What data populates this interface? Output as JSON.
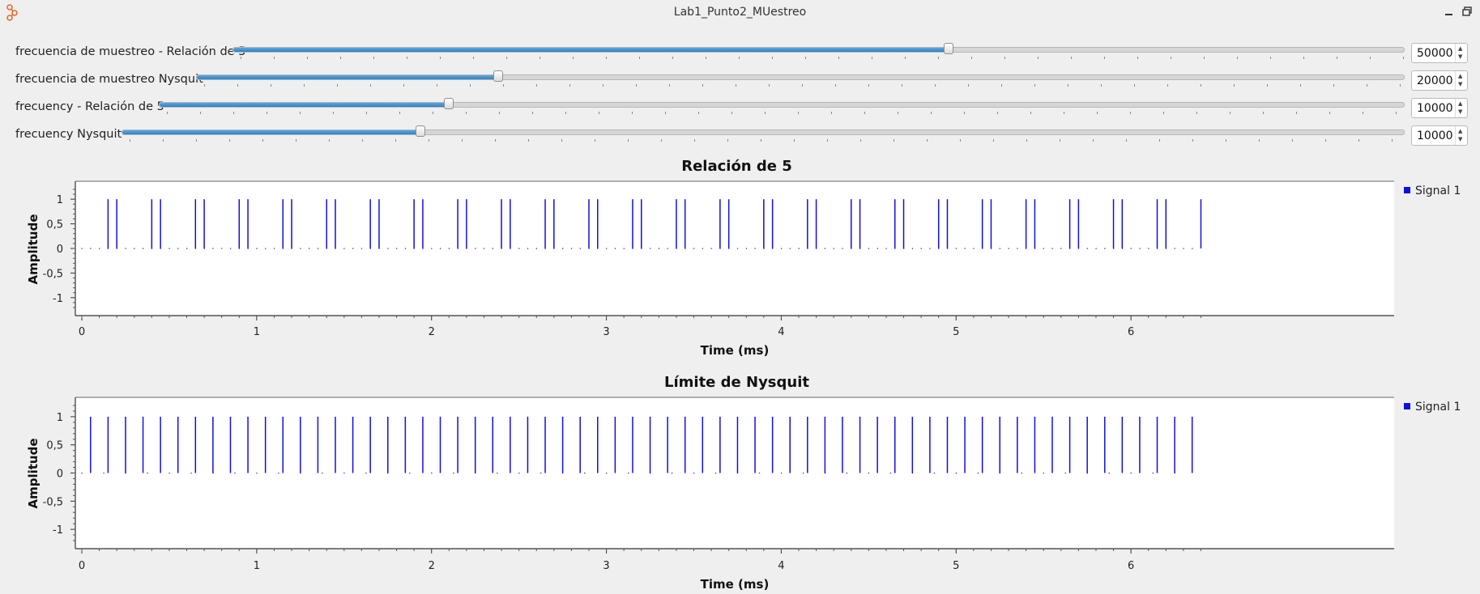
{
  "window": {
    "title": "Lab1_Punto2_MUestreo"
  },
  "controls": [
    {
      "label": "frecuencia de muestreo - Relación de 5",
      "value": "50000",
      "fraction": 0.612
    },
    {
      "label": "frecuencia de muestreo Nysquit",
      "value": "20000",
      "fraction": 0.25
    },
    {
      "label": "frecuency - Relación de 5",
      "value": "10000",
      "fraction": 0.233
    },
    {
      "label": "frecuency Nysquit",
      "value": "10000",
      "fraction": 0.233
    }
  ],
  "plots": [
    {
      "title": "Relación de 5",
      "xlabel": "Time (ms)",
      "ylabel": "Amplitude",
      "legend": "Signal 1",
      "x_ticks": [
        "0",
        "1",
        "2",
        "3",
        "4",
        "5",
        "6"
      ],
      "y_ticks": [
        "1",
        "0,5",
        "0",
        "-0,5",
        "-1"
      ],
      "chart_data": {
        "type": "stem",
        "xlim": [
          0,
          6.4
        ],
        "ylim": [
          -1.2,
          1.2
        ],
        "sample_interval_ms": 0.02,
        "pulse_period_ms": 0.25,
        "pulse_offsets_ms": [
          0.15,
          0.2
        ],
        "pulse_count": 26,
        "amplitude": 1,
        "color": "#1010e0"
      }
    },
    {
      "title": "Límite de Nysquit",
      "xlabel": "Time (ms)",
      "ylabel": "Amplitude",
      "legend": "Signal 1",
      "x_ticks": [
        "0",
        "1",
        "2",
        "3",
        "4",
        "5",
        "6"
      ],
      "y_ticks": [
        "1",
        "0,5",
        "0",
        "-0,5",
        "-1"
      ],
      "chart_data": {
        "type": "stem",
        "xlim": [
          0,
          6.4
        ],
        "ylim": [
          -1.2,
          1.2
        ],
        "sample_interval_ms": 0.05,
        "pulse_period_ms": 0.1,
        "pulse_offsets_ms": [
          0.05
        ],
        "pulse_count": 64,
        "amplitude": 1,
        "color": "#1010e0"
      }
    }
  ]
}
